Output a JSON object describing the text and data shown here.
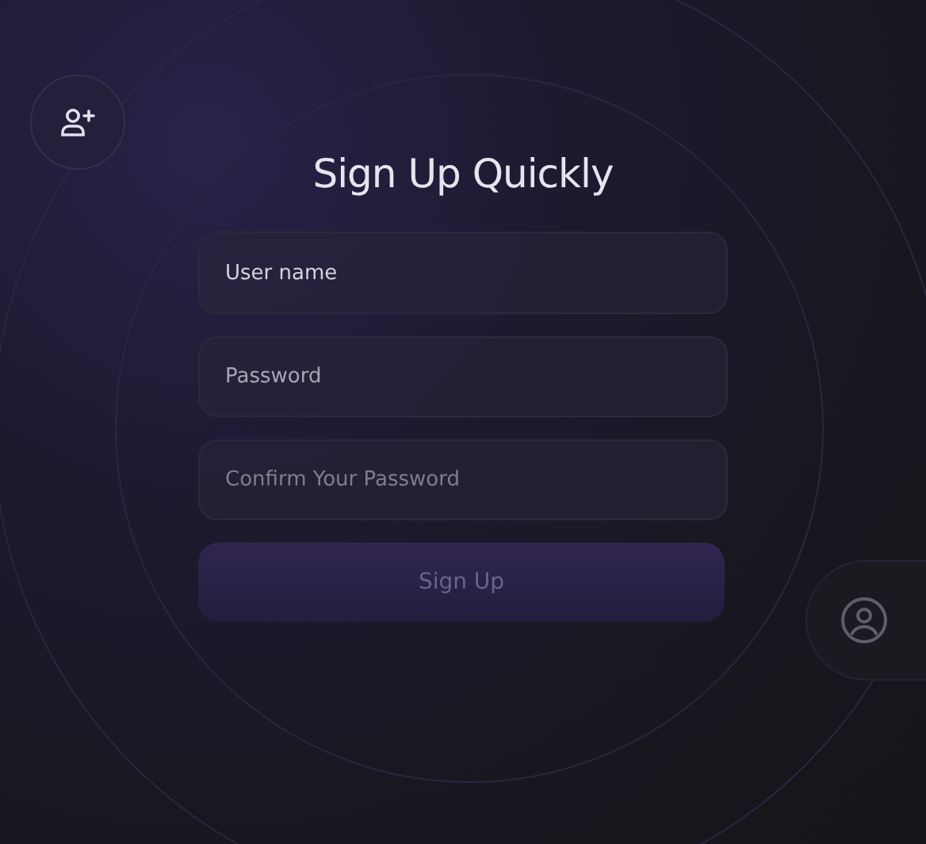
{
  "title": "Sign Up Quickly",
  "fields": [
    {
      "placeholder": "User name"
    },
    {
      "placeholder": "Password"
    },
    {
      "placeholder": "Confirm Your Password"
    }
  ],
  "submit": {
    "label": "Sign Up",
    "disabled": true
  }
}
